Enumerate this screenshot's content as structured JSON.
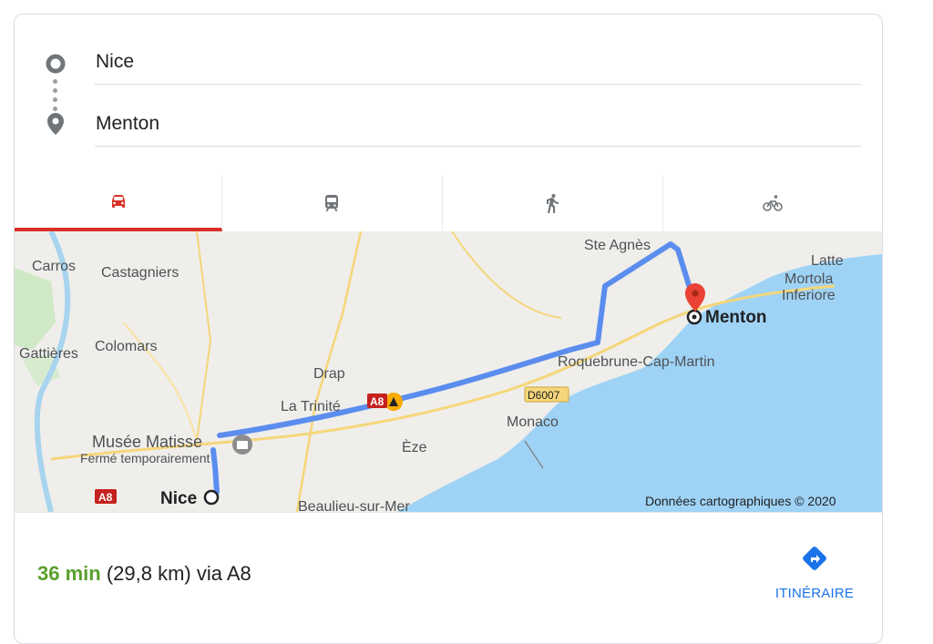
{
  "route": {
    "origin_value": "Nice",
    "destination_value": "Menton"
  },
  "modes": [
    {
      "name": "car-icon",
      "active": true
    },
    {
      "name": "transit-icon",
      "active": false
    },
    {
      "name": "walk-icon",
      "active": false
    },
    {
      "name": "bike-icon",
      "active": false
    }
  ],
  "map": {
    "labels": {
      "ste_agnes": "Ste Agnès",
      "latte": "Latte",
      "carros": "Carros",
      "castagniers": "Castagniers",
      "mortola": "Mortola",
      "inferiore": "Inferiore",
      "menton": "Menton",
      "gattieres": "Gattières",
      "colomars": "Colomars",
      "roquebrune": "Roquebrune-Cap-Martin",
      "drap": "Drap",
      "la_trinite": "La Trinité",
      "a8_shield_top": "A8",
      "d6007": "D6007",
      "monaco": "Monaco",
      "musee_matisse": "Musée Matisse",
      "ferme": "Fermé temporairement",
      "eze": "Èze",
      "a8_shield": "A8",
      "nice": "Nice",
      "beaulieu": "Beaulieu-sur-Mer",
      "attribution": "Données cartographiques © 2020"
    },
    "colors": {
      "land": "#efeeea",
      "sea": "#9fd3f5",
      "route": "#5b8def",
      "marker": "#ea4335"
    }
  },
  "summary": {
    "duration": "36 min",
    "details": " (29,8 km) via A8",
    "directions_label": "ITINÉRAIRE"
  }
}
